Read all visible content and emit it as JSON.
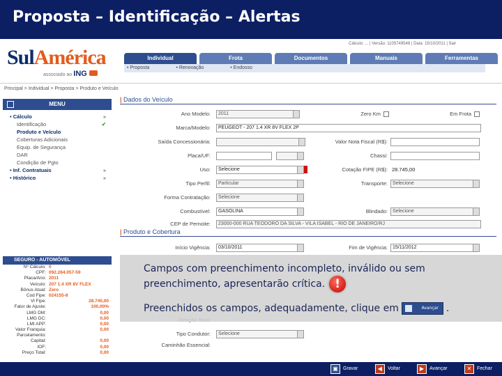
{
  "slide_title": "Proposta – Identificação – Alertas",
  "logo": {
    "brand_1": "Sul",
    "brand_2": "América",
    "associated": "associado ao",
    "partner": "ING"
  },
  "toplinks": "Cálculo: ... | Versão: 1105749548 | Data: 15/10/2011 | Sair",
  "nav": {
    "tabs": [
      "Individual",
      "Frota",
      "Documentos",
      "Manuais",
      "Ferramentas"
    ]
  },
  "subnav": [
    "Proposta",
    "Renovação",
    "Endosso"
  ],
  "breadcrumb": "Principal > Individual > Proposta > Produto e Veículo",
  "menu": {
    "title": "MENU",
    "items": [
      {
        "label": "Cálculo",
        "level": 0,
        "arrow": "»"
      },
      {
        "label": "Identificação",
        "level": 1,
        "check": "✔"
      },
      {
        "label": "Produto e Veículo",
        "level": 1,
        "bold": true
      },
      {
        "label": "Coberturas Adicionais",
        "level": 1
      },
      {
        "label": "Equip. de Segurança",
        "level": 1
      },
      {
        "label": "DAR",
        "level": 1
      },
      {
        "label": "Condição de Pgto",
        "level": 1
      },
      {
        "label": "Inf. Contratuais",
        "level": 0,
        "arrow": "»"
      },
      {
        "label": "Histórico",
        "level": 0,
        "arrow": "»"
      }
    ]
  },
  "seguro": {
    "title": "SEGURO - AUTOMÓVEL",
    "rows": [
      {
        "k": "Nº Cálculo:",
        "v": "0"
      },
      {
        "k": "CPF:",
        "v": "092.284.057-59"
      },
      {
        "k": "Placa/Ano:",
        "v": "2011"
      },
      {
        "k": "Veículo:",
        "v": "207 1.4 XR 8V FLEX"
      },
      {
        "k": "Bônus Atual:",
        "v": "Zero"
      },
      {
        "k": "Cod Fipe:",
        "v": "024155-8"
      },
      {
        "k": "Vl Fipe:",
        "v": "",
        "v2": "28.745,00"
      },
      {
        "k": "Fator de Ajuste:",
        "v": "",
        "v2": "100,00%"
      },
      {
        "k": "LMG DM:",
        "v": "",
        "v2": "0,00"
      },
      {
        "k": "LMG DC:",
        "v": "",
        "v2": "0,00"
      },
      {
        "k": "LMI APP:",
        "v": "",
        "v2": "0,00"
      },
      {
        "k": "Valor Franquia:",
        "v": "",
        "v2": "0,00"
      },
      {
        "k": "Parcelamento:",
        "v": "",
        "v2": ""
      },
      {
        "k": "Capital:",
        "v": "",
        "v2": "0,00"
      },
      {
        "k": "IOF:",
        "v": "",
        "v2": "0,00"
      },
      {
        "k": "Preço Total:",
        "v": "",
        "v2": "0,00"
      }
    ]
  },
  "form": {
    "section_vehicle": "Dados do Veículo",
    "section_product": "Produto e Cobertura",
    "fields": {
      "ano_modelo_label": "Ano Modelo:",
      "ano_modelo_value": "2011",
      "zero_km_label": "Zero Km",
      "frota_label": "Em Frota",
      "marca_label": "Marca/Modelo:",
      "marca_value": "PEUGEOT - 207 1.4 XR 8V FLEX 2P",
      "saida_label": "Saída Concessionária:",
      "valor_nota_label": "Valor Nota Fiscal (R$):",
      "placa_label": "Placa/UF:",
      "chassi_label": "Chassi:",
      "uso_label": "Uso:",
      "uso_value": "Selecione",
      "cotacao_label": "Cotação FIPE (R$):",
      "cotacao_value": "28.745,00",
      "tipo_perfil_label": "Tipo Perfil:",
      "tipo_perfil_value": "Particular",
      "transporte_label": "Transporte:",
      "transporte_value": "Selecione",
      "forma_label": "Forma Contratação:",
      "forma_value": "Selecione",
      "combustivel_label": "Combustível:",
      "combustivel_value": "GASOLINA",
      "blindado_label": "Blindado:",
      "blindado_value": "Selecione",
      "cep_label": "CEP de Pernoite:",
      "cep_value": "23000-000 RUA TEODORO DA SILVA - VILA ISABEL - RIO DE JANEIRO/RJ",
      "inicio_label": "Início Vigência:",
      "inicio_value": "03/10/2011",
      "fim_label": "Fim de Vigência:",
      "fim_value": "15/11/2012",
      "isencao_label": "Isenção Taxa:",
      "tipo_con_label": "Tipo Condutor:",
      "tipo_con_value": "Selecione",
      "caminhao_label": "Caminhão Essencial:"
    }
  },
  "overlay": {
    "line1": "Campos com preenchimento incompleto, inválido ou sem preenchimento, apresentarão crítica.",
    "line2_before": "Preenchidos os campos, adequadamente, clique em",
    "line2_after": ".",
    "button_text": "Avançar",
    "alert_glyph": "!"
  },
  "footer": {
    "gravar": "Gravar",
    "voltar": "Voltar",
    "avancar": "Avançar",
    "fechar": "Fechar"
  }
}
